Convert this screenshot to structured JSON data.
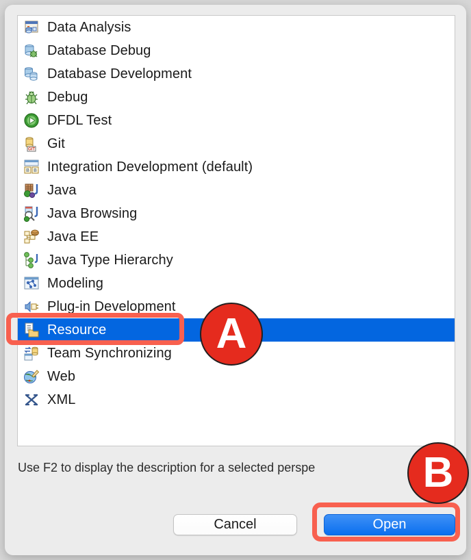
{
  "dialog": {
    "hint_text": "Use F2 to display the description for a selected perspe",
    "buttons": {
      "cancel_label": "Cancel",
      "open_label": "Open"
    }
  },
  "list": {
    "selected_index": 12,
    "items": [
      {
        "label": "Data Analysis",
        "icon": "data-analysis-icon"
      },
      {
        "label": "Database Debug",
        "icon": "database-debug-icon"
      },
      {
        "label": "Database Development",
        "icon": "database-development-icon"
      },
      {
        "label": "Debug",
        "icon": "debug-bug-icon"
      },
      {
        "label": "DFDL Test",
        "icon": "dfdl-test-play-icon"
      },
      {
        "label": "Git",
        "icon": "git-icon"
      },
      {
        "label": "Integration Development (default)",
        "icon": "integration-development-icon"
      },
      {
        "label": "Java",
        "icon": "java-icon"
      },
      {
        "label": "Java Browsing",
        "icon": "java-browsing-icon"
      },
      {
        "label": "Java EE",
        "icon": "java-ee-icon"
      },
      {
        "label": "Java Type Hierarchy",
        "icon": "java-type-hierarchy-icon"
      },
      {
        "label": "Modeling",
        "icon": "modeling-icon"
      },
      {
        "label": "Plug-in Development",
        "icon": "plugin-development-icon"
      },
      {
        "label": "Resource",
        "icon": "resource-icon"
      },
      {
        "label": "Team Synchronizing",
        "icon": "team-synchronizing-icon"
      },
      {
        "label": "Web",
        "icon": "web-icon"
      },
      {
        "label": "XML",
        "icon": "xml-icon"
      }
    ]
  },
  "annotations": {
    "badge_a_label": "A",
    "badge_b_label": "B",
    "badge_color": "#e52b1e",
    "rect_color": "#f8604f"
  },
  "colors": {
    "selection_blue": "#0366e0",
    "open_button_blue": "#0a6fef",
    "dialog_background": "#ececec",
    "list_background": "#ffffff"
  }
}
